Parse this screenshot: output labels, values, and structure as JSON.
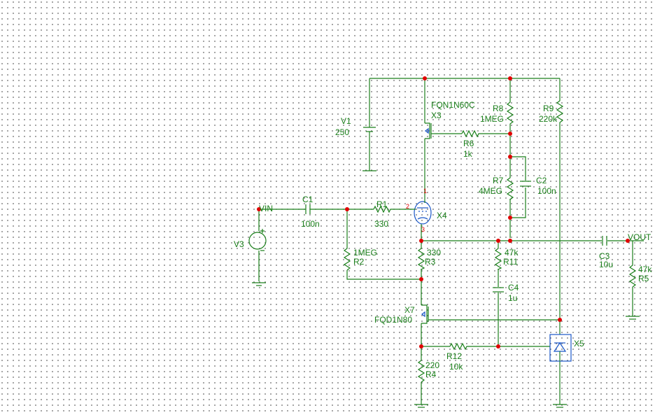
{
  "nets": {
    "vin": "VIN",
    "vout": "VOUT"
  },
  "components": {
    "v1": {
      "ref": "V1",
      "value": "250"
    },
    "v3": {
      "ref": "V3"
    },
    "c1": {
      "ref": "C1",
      "value": "100n"
    },
    "c2": {
      "ref": "C2",
      "value": "100n"
    },
    "c3": {
      "ref": "C3",
      "value": "10u"
    },
    "c4": {
      "ref": "C4",
      "value": "1u"
    },
    "r1": {
      "ref": "R1",
      "value": "330"
    },
    "r2": {
      "ref": "R2",
      "value": "1MEG"
    },
    "r3": {
      "ref": "R3",
      "value": "330"
    },
    "r4": {
      "ref": "R4",
      "value": "220"
    },
    "r5": {
      "ref": "R5",
      "value": "47k"
    },
    "r6": {
      "ref": "R6",
      "value": "1k"
    },
    "r7": {
      "ref": "R7",
      "value": "4MEG"
    },
    "r8": {
      "ref": "R8",
      "value": "1MEG"
    },
    "r9": {
      "ref": "R9",
      "value": "220k"
    },
    "r11": {
      "ref": "R11",
      "value": "47k"
    },
    "r12": {
      "ref": "R12",
      "value": "10k"
    },
    "x3": {
      "ref": "X3",
      "value": "FQN1N60C"
    },
    "x4": {
      "ref": "X4",
      "pins": [
        "1",
        "2",
        "3"
      ]
    },
    "x5": {
      "ref": "X5"
    },
    "x7": {
      "ref": "X7",
      "value": "FQD1N80"
    }
  },
  "colors": {
    "wire": "#1a7f1a",
    "symbol": "#1a57c8",
    "junction": "#e00000",
    "grid_dot": "#555555"
  }
}
